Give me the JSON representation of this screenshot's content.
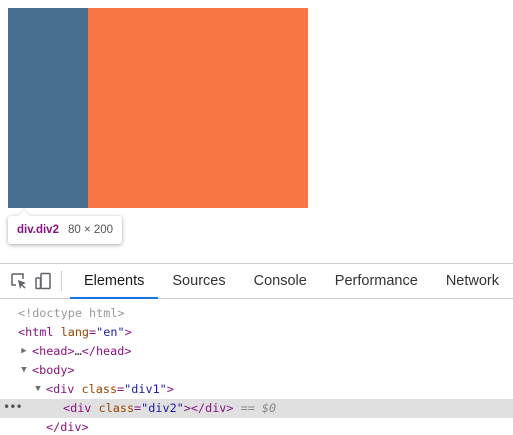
{
  "page": {
    "div1": {
      "color": "#f97744"
    },
    "div2": {
      "color": "#486e92"
    }
  },
  "tooltip": {
    "element_name": "div.div2",
    "size": "80 × 200"
  },
  "devtools": {
    "icons": {
      "inspect": "inspect-element-icon",
      "device": "device-toolbar-icon"
    },
    "tabs": [
      {
        "label": "Elements",
        "active": true
      },
      {
        "label": "Sources",
        "active": false
      },
      {
        "label": "Console",
        "active": false
      },
      {
        "label": "Performance",
        "active": false
      },
      {
        "label": "Network",
        "active": false
      }
    ],
    "accent_color": "#1a73e8",
    "tree": {
      "doctype": "<!doctype html>",
      "html_open": "<html",
      "html_attr": "lang",
      "html_val": "\"en\"",
      "head_open": "<head>",
      "head_ellipsis": "…",
      "head_close": "</head>",
      "body_open": "<body>",
      "div1_open": "<div",
      "div1_attr": "class",
      "div1_val": "\"div1\"",
      "div2_open": "<div",
      "div2_attr": "class",
      "div2_val": "\"div2\"",
      "div2_close": "></div>",
      "selected_marker": "== $0",
      "div_close": "</div>"
    }
  }
}
